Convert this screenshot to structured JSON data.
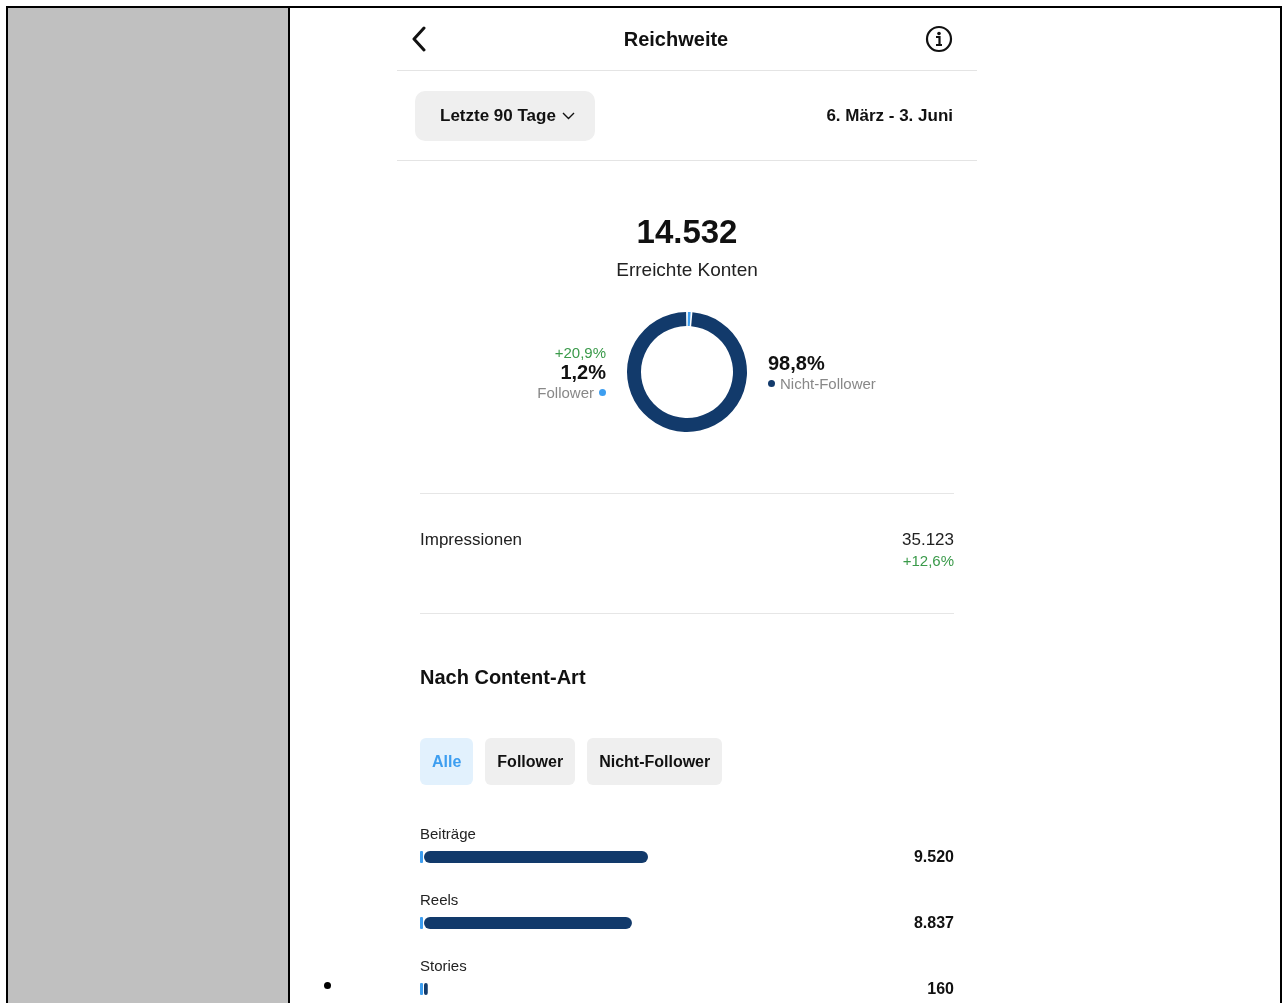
{
  "header": {
    "title": "Reichweite"
  },
  "period": {
    "label": "Letzte 90 Tage",
    "range": "6. März - 3. Juni"
  },
  "reach": {
    "value": "14.532",
    "label": "Erreichte Konten",
    "follower": {
      "change": "+20,9%",
      "percent": "1,2%",
      "color": "#3d9ef0"
    },
    "non_follower": {
      "percent": "98,8%",
      "color": "#123a6b"
    },
    "chart_data": {
      "type": "donut",
      "categories": [
        "Follower",
        "Nicht-Follower"
      ],
      "values": [
        1.2,
        98.8
      ]
    }
  },
  "impressions": {
    "label": "Impressionen",
    "value": "35.123",
    "change": "+12,6%"
  },
  "content_type": {
    "title": "Nach Content-Art",
    "filters": [
      {
        "label": "Alle",
        "selected": true
      },
      {
        "label": "Follower",
        "selected": false
      },
      {
        "label": "Nicht-Follower",
        "selected": false
      }
    ],
    "chart_data": {
      "type": "bar",
      "orientation": "horizontal",
      "categories": [
        "Beiträge",
        "Reels",
        "Stories"
      ],
      "values": [
        9520,
        8837,
        160
      ],
      "value_labels": [
        "9.520",
        "8.837",
        "160"
      ]
    }
  }
}
